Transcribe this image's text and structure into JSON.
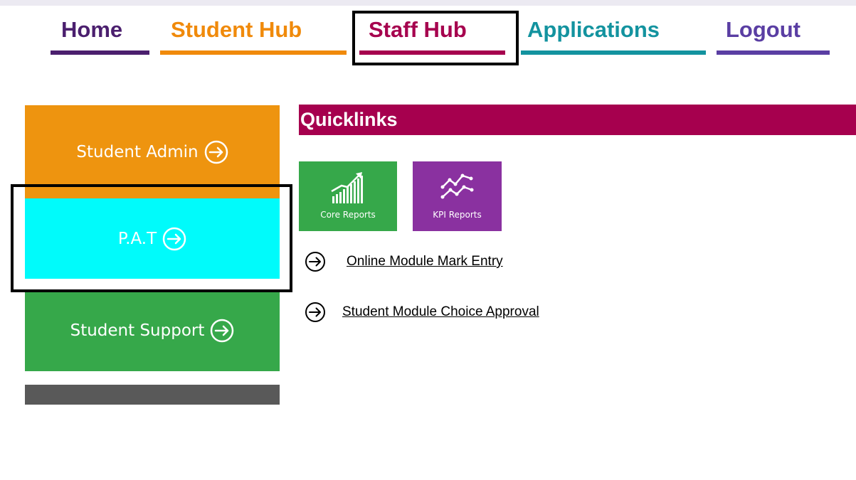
{
  "nav": {
    "items": [
      {
        "label": "Home",
        "color": "#4b1f6e"
      },
      {
        "label": "Student Hub",
        "color": "#f08a0b"
      },
      {
        "label": "Staff Hub",
        "color": "#a6004e"
      },
      {
        "label": "Applications",
        "color": "#13939f"
      },
      {
        "label": "Logout",
        "color": "#5a3ea3"
      }
    ]
  },
  "sidebar": {
    "items": [
      {
        "label": "Student Admin",
        "color": "#ee940f",
        "icon": "arrow-circle-right-icon"
      },
      {
        "label": "P.A.T",
        "color": "#00fbfb",
        "icon": "arrow-circle-right-icon"
      },
      {
        "label": "Student Support",
        "color": "#36a84a",
        "icon": "arrow-circle-right-icon"
      }
    ],
    "footer_bar_color": "#595959"
  },
  "quicklinks": {
    "title": "Quicklinks",
    "header_color": "#a6004e",
    "tiles": [
      {
        "label": "Core Reports",
        "color": "#36a84a",
        "icon": "bar-chart-growth-icon"
      },
      {
        "label": "KPI Reports",
        "color": "#8a31a0",
        "icon": "line-chart-icon"
      }
    ],
    "links": [
      {
        "label": "Online Module Mark Entry",
        "icon": "arrow-circle-right-icon"
      },
      {
        "label": "Student Module Choice Approval",
        "icon": "arrow-circle-right-icon"
      }
    ]
  }
}
